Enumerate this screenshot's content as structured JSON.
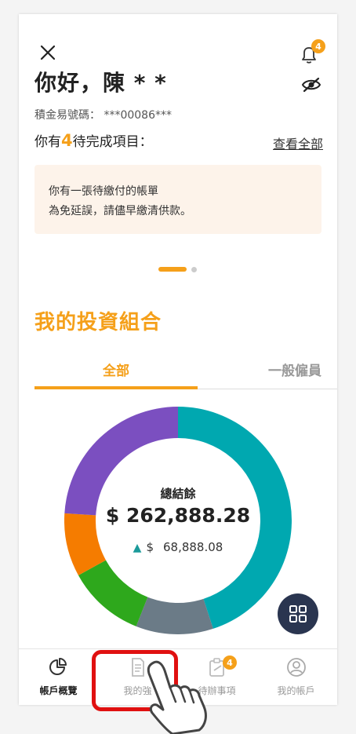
{
  "header": {
    "greeting": "你好，陳 * *",
    "account_label": "積金易號碼： ***00086***",
    "todo_prefix": "你有",
    "todo_count": "4",
    "todo_suffix": "待完成項目：",
    "view_all": "查看全部",
    "notification_count": "4"
  },
  "notice": {
    "line1": "你有一張待繳付的帳單",
    "line2": "為免延誤，請儘早繳清供款。"
  },
  "carousel": {
    "pages": 2,
    "active": 1
  },
  "portfolio": {
    "title": "我的投資組合",
    "tabs": [
      {
        "label": "全部",
        "active": true
      },
      {
        "label": "一般僱員",
        "active": false
      }
    ],
    "total_label": "總結餘",
    "total_value": "$ 262,888.28",
    "change_currency": "$",
    "change_value": "68,888.08"
  },
  "chart_data": {
    "type": "pie",
    "variant": "donut",
    "slices": [
      {
        "color": "#00a8b0",
        "fraction": 0.45
      },
      {
        "color": "#6b7b87",
        "fraction": 0.11
      },
      {
        "color": "#2ea81c",
        "fraction": 0.11
      },
      {
        "color": "#f57c00",
        "fraction": 0.09
      },
      {
        "color": "#7b4fc0",
        "fraction": 0.24
      }
    ]
  },
  "nav": {
    "items": [
      {
        "label": "帳戶概覽",
        "icon": "pie-chart-icon",
        "active": true
      },
      {
        "label": "我的強",
        "icon": "document-icon",
        "active": false
      },
      {
        "label": "待辦事項",
        "icon": "clipboard-icon",
        "active": false,
        "badge": "4"
      },
      {
        "label": "我的帳戶",
        "icon": "user-icon",
        "active": false
      }
    ]
  },
  "colors": {
    "accent": "#f5a01a",
    "notice_bg": "#fdf3ea",
    "fab": "#2a3550",
    "highlight": "#e01010"
  }
}
